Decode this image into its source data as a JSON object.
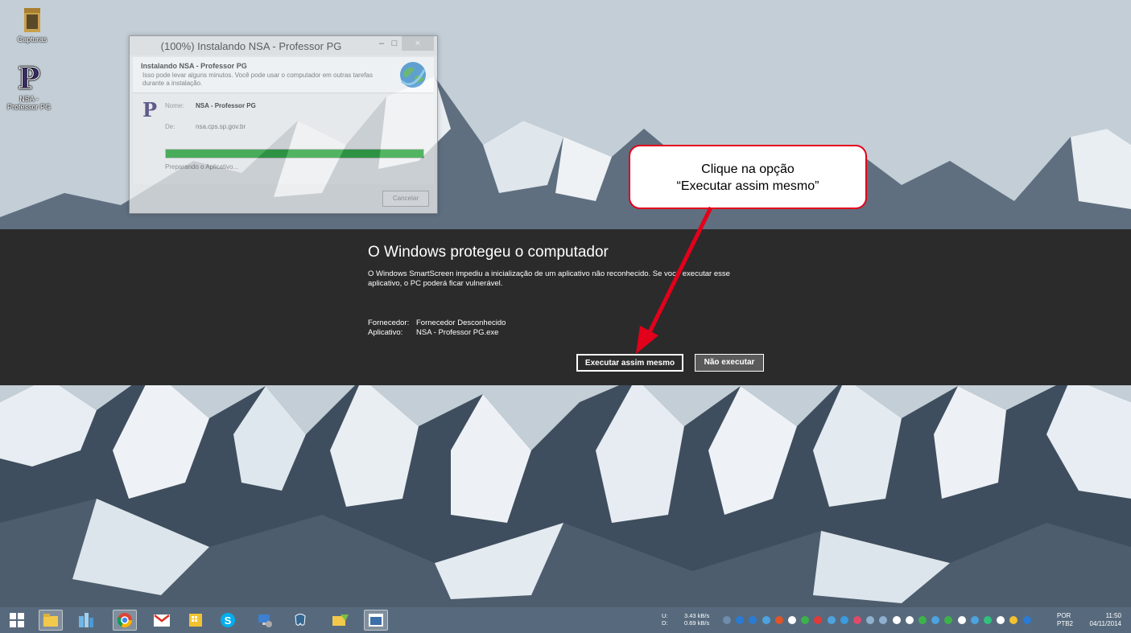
{
  "desktop": {
    "icons": [
      {
        "label": "Capturas",
        "icon": "folder-icon"
      },
      {
        "label": "NSA - Professor PG",
        "icon": "professor-pg-app-icon"
      }
    ]
  },
  "installer": {
    "title": "(100%) Instalando NSA - Professor PG",
    "header_title": "Instalando NSA - Professor PG",
    "header_desc": "Isso pode levar alguns minutos. Você pode usar o computador em outras tarefas durante a instalação.",
    "name_label": "Nome:",
    "name_value": "NSA - Professor PG",
    "from_label": "De:",
    "from_value": "nsa.cps.sp.gov.br",
    "progress": 1.0,
    "status": "Preparando o Aplicativo...",
    "cancel_label": "Cancelar",
    "min_glyph": "–",
    "max_glyph": "□",
    "close_glyph": "×"
  },
  "smartscreen": {
    "heading": "O Windows protegeu o computador",
    "message": "O Windows SmartScreen impediu a inicialização de um aplicativo não reconhecido. Se você executar esse aplicativo, o PC poderá ficar vulnerável.",
    "publisher_label": "Fornecedor:",
    "publisher_value": "Fornecedor Desconhecido",
    "app_label": "Aplicativo:",
    "app_value": "NSA - Professor PG.exe",
    "run_button": "Executar assim mesmo",
    "dont_run_button": "Não executar"
  },
  "callout": {
    "line1": "Clique na opção",
    "line2": "“Executar assim mesmo”",
    "border_color": "#e3001b"
  },
  "taskbar": {
    "apps": [
      "windows-start-icon",
      "file-explorer-icon",
      "app-store-icon",
      "chrome-icon",
      "gmail-icon",
      "office-icon",
      "skype-icon",
      "remote-desktop-icon",
      "postgres-icon",
      "folder-sync-icon",
      "window-icon"
    ],
    "net_up_label": "U:",
    "net_down_label": "D:",
    "net_up": "3.43 kB/s",
    "net_down": "0.69 kB/s",
    "lang_top": "POR",
    "lang_bottom": "PTB2",
    "time": "11:50",
    "date": "04/11/2014"
  }
}
